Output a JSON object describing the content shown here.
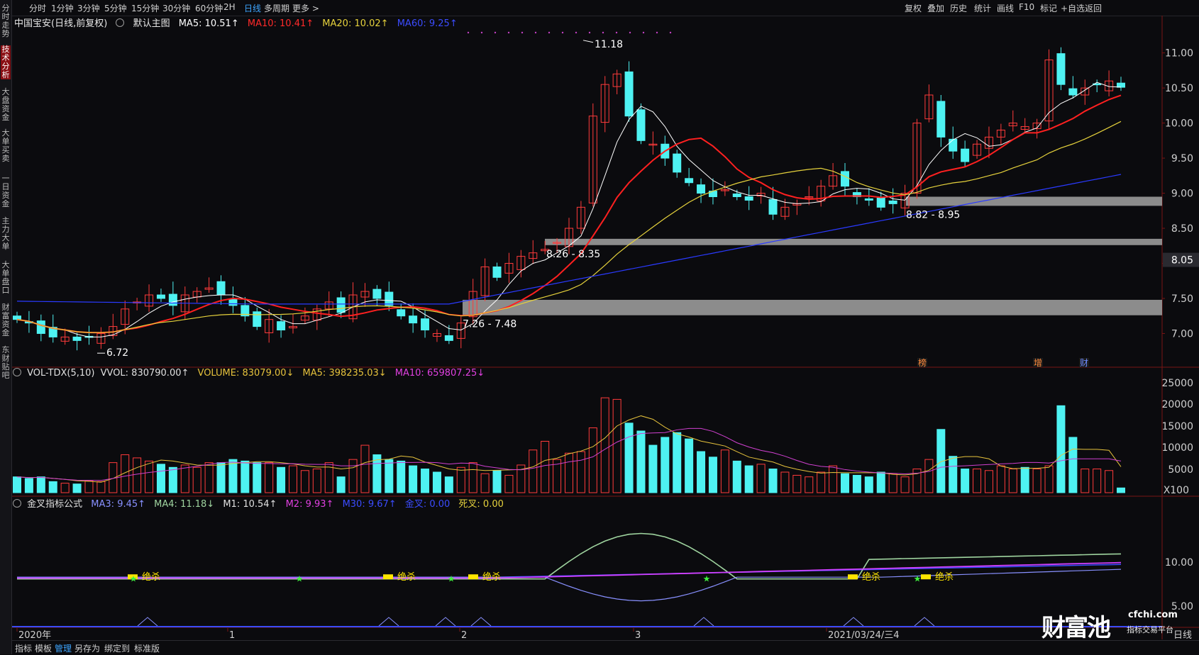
{
  "toolbar": {
    "periods": [
      "分时",
      "1分钟",
      "3分钟",
      "5分钟",
      "15分钟",
      "30分钟",
      "60分钟",
      "2H",
      "日线",
      "多周期",
      "更多 >"
    ],
    "active_period": "日线",
    "right_actions": [
      "复权",
      "叠加",
      "历史",
      "统计",
      "画线",
      "F10",
      "标记",
      "+自选",
      "返回"
    ]
  },
  "left_rail": {
    "tabs": [
      "分时走势",
      "技术分析",
      "大盘资金",
      "大单买卖",
      "一日资金",
      "主力大单",
      "大单盘口",
      "财富资金",
      "东财贴吧"
    ],
    "active": "技术分析"
  },
  "main_legend": {
    "title": "中国宝安(日线,前复权)",
    "template": "默认主图",
    "ma5": "MA5: 10.51↑",
    "ma10": "MA10: 10.41↑",
    "ma20": "MA20: 10.02↑",
    "ma60": "MA60: 9.25↑"
  },
  "price_axis": [
    "11.00",
    "10.50",
    "10.00",
    "9.50",
    "9.00",
    "8.50",
    "8.00",
    "7.50",
    "7.00"
  ],
  "current_price_tag": "8.05",
  "annotations": {
    "high": "11.18",
    "low": "6.72",
    "zone1": "7.26 - 7.48",
    "zone2": "8.26 - 8.35",
    "zone3": "8.82 - 8.95"
  },
  "event_marks": [
    "榜",
    "增",
    "财"
  ],
  "vol_legend": {
    "name": "VOL-TDX(5,10)",
    "vvol": "VVOL: 830790.00↑",
    "volume": "VOLUME: 83079.00↓",
    "ma5": "MA5: 398235.03↓",
    "ma10": "MA10: 659807.25↓"
  },
  "vol_axis": [
    "25000",
    "20000",
    "15000",
    "10000",
    "5000"
  ],
  "vol_unit": "X100",
  "ind_legend": {
    "name": "金叉指标公式",
    "ma3": "MA3: 9.45↑",
    "ma4": "MA4: 11.18↓",
    "m1": "M1: 10.54↑",
    "m2": "M2: 9.93↑",
    "m30": "M30: 9.67↑",
    "golden": "金叉: 0.00",
    "death": "死叉: 0.00"
  },
  "ind_axis": [
    "10.00",
    "5.00"
  ],
  "signal_label": "绝杀",
  "date_axis": [
    "2020年",
    "1",
    "2",
    "3",
    "2021/03/24/三4"
  ],
  "period_label": "日线",
  "bottom_tabs": [
    "指标",
    "模板",
    "管理",
    "另存为",
    "绑定到",
    "标准版"
  ],
  "bottom_active": "管理",
  "watermark": {
    "logo": "财富池",
    "site": "cfchi.com",
    "sub": "指标交易平台"
  },
  "colors": {
    "up": "#ff3b3b",
    "down": "#4ef2f2",
    "ma5": "#ffffff",
    "ma10": "#ff2020",
    "ma20": "#e6d23c",
    "ma60": "#2a3aff",
    "accent": "#3ea6ff"
  }
}
